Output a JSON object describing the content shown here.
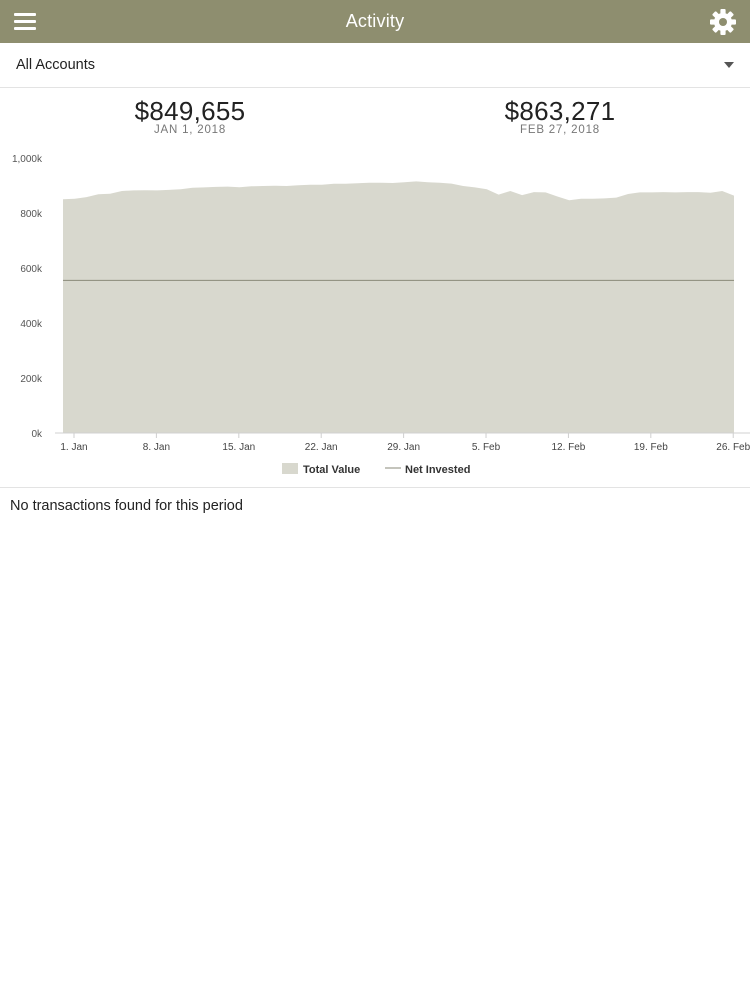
{
  "header": {
    "title": "Activity",
    "menu_icon": "hamburger-menu-icon",
    "settings_icon": "gear-icon"
  },
  "account_selector": {
    "selected": "All Accounts"
  },
  "summary": {
    "start": {
      "amount": "$849,655",
      "date": "JAN 1, 2018"
    },
    "end": {
      "amount": "$863,271",
      "date": "FEB 27, 2018"
    }
  },
  "chart_data": {
    "type": "area",
    "x_tick_labels": [
      "1. Jan",
      "8. Jan",
      "15. Jan",
      "22. Jan",
      "29. Jan",
      "5. Feb",
      "12. Feb",
      "19. Feb",
      "26. Feb"
    ],
    "y_tick_labels": [
      "0k",
      "200k",
      "400k",
      "600k",
      "800k",
      "1,000k"
    ],
    "ylim": [
      0,
      1000000
    ],
    "x_range_days": [
      0,
      57
    ],
    "legend": {
      "position": "bottom"
    },
    "colors": {
      "total_value": "#d8d8ce",
      "net_invested": "#8a8a7a"
    },
    "series": [
      {
        "name": "Total Value",
        "type": "area",
        "x_days": [
          0,
          1,
          2,
          3,
          4,
          5,
          6,
          7,
          8,
          9,
          10,
          11,
          12,
          13,
          14,
          15,
          16,
          17,
          18,
          19,
          20,
          21,
          22,
          23,
          24,
          25,
          26,
          27,
          28,
          29,
          30,
          31,
          32,
          33,
          34,
          35,
          36,
          37,
          38,
          39,
          40,
          41,
          42,
          43,
          44,
          45,
          46,
          47,
          48,
          49,
          50,
          51,
          52,
          53,
          54,
          55,
          56,
          57
        ],
        "values": [
          850000,
          852000,
          858000,
          868000,
          870000,
          880000,
          882000,
          883000,
          882000,
          884000,
          886000,
          892000,
          893000,
          895000,
          896000,
          894000,
          897000,
          898000,
          899000,
          898000,
          901000,
          903000,
          903000,
          906000,
          906000,
          908000,
          910000,
          910000,
          909000,
          912000,
          915000,
          912000,
          910000,
          907000,
          898000,
          893000,
          886000,
          867000,
          880000,
          865000,
          876000,
          875000,
          860000,
          846000,
          852000,
          852000,
          853000,
          856000,
          869000,
          875000,
          875000,
          876000,
          875000,
          876000,
          876000,
          874000,
          880000,
          863271
        ]
      },
      {
        "name": "Net Invested",
        "type": "line",
        "x_days": [
          0,
          57
        ],
        "values": [
          555000,
          555000
        ]
      }
    ]
  }
}
